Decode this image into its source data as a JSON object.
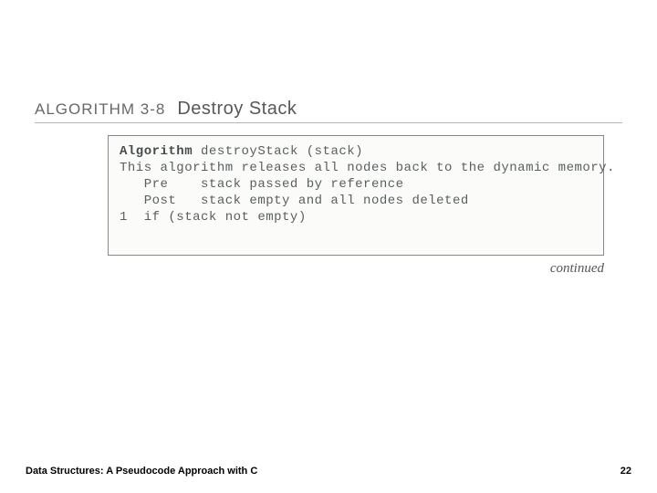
{
  "header": {
    "label": "ALGORITHM 3-8",
    "title": "Destroy Stack"
  },
  "code": {
    "line1_kw": "Algorithm",
    "line1_rest": " destroyStack (stack)",
    "line2": "This algorithm releases all nodes back to the dynamic memory.",
    "line3": "   Pre    stack passed by reference",
    "line4": "   Post   stack empty and all nodes deleted",
    "line5": "1  if (stack not empty)"
  },
  "continued": "continued",
  "footer": {
    "left": "Data Structures: A Pseudocode Approach with C",
    "right": "22"
  }
}
